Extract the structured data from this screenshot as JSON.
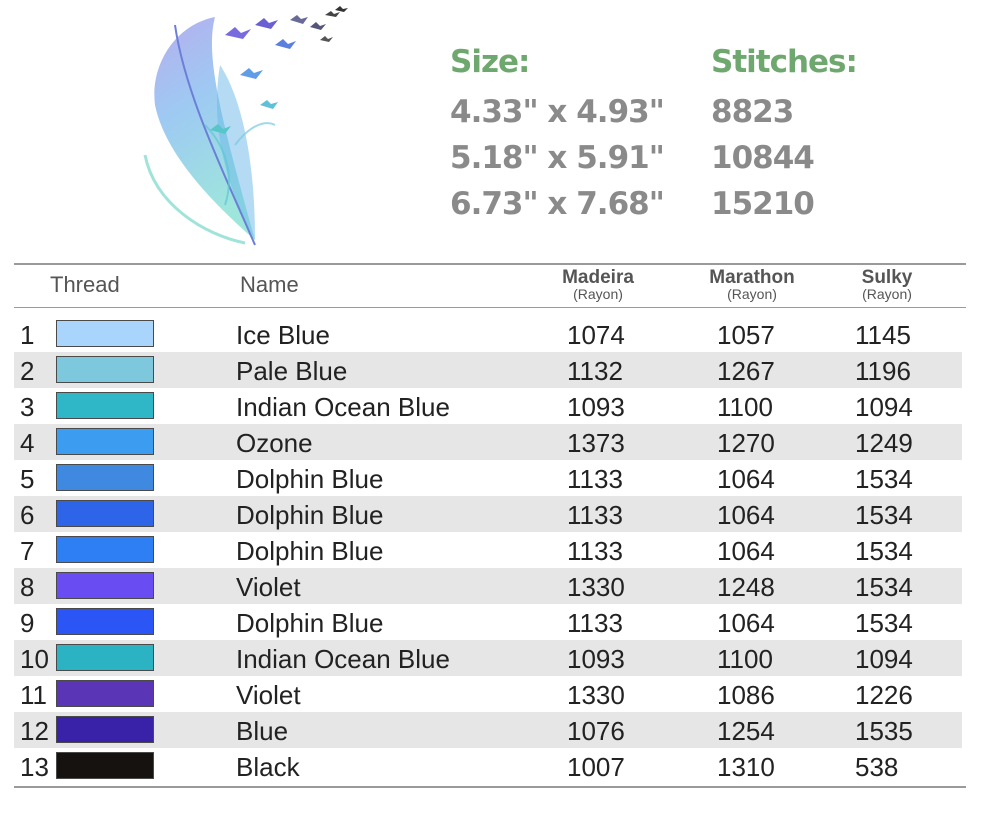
{
  "specs": {
    "size_label": "Size:",
    "stitches_label": "Stitches:",
    "sizes": [
      "4.33\" x 4.93\"",
      "5.18\" x 5.91\"",
      "6.73\" x 7.68\""
    ],
    "stitches": [
      "8823",
      "10844",
      "15210"
    ]
  },
  "table": {
    "headers": {
      "thread": "Thread",
      "name": "Name",
      "madeira": "Madeira",
      "marathon": "Marathon",
      "sulky": "Sulky",
      "rayon": "(Rayon)"
    },
    "rows": [
      {
        "n": "1",
        "color": "#a9d4fb",
        "name": "Ice Blue",
        "madeira": "1074",
        "marathon": "1057",
        "sulky": "1145"
      },
      {
        "n": "2",
        "color": "#7ec8de",
        "name": "Pale Blue",
        "madeira": "1132",
        "marathon": "1267",
        "sulky": "1196"
      },
      {
        "n": "3",
        "color": "#2fb6c7",
        "name": "Indian Ocean Blue",
        "madeira": "1093",
        "marathon": "1100",
        "sulky": "1094"
      },
      {
        "n": "4",
        "color": "#3b9cf0",
        "name": "Ozone",
        "madeira": "1373",
        "marathon": "1270",
        "sulky": "1249"
      },
      {
        "n": "5",
        "color": "#3f8ae0",
        "name": "Dolphin Blue",
        "madeira": "1133",
        "marathon": "1064",
        "sulky": "1534"
      },
      {
        "n": "6",
        "color": "#2d64e8",
        "name": "Dolphin Blue",
        "madeira": "1133",
        "marathon": "1064",
        "sulky": "1534"
      },
      {
        "n": "7",
        "color": "#2e7ef4",
        "name": "Dolphin Blue",
        "madeira": "1133",
        "marathon": "1064",
        "sulky": "1534"
      },
      {
        "n": "8",
        "color": "#6a4df2",
        "name": "Violet",
        "madeira": "1330",
        "marathon": "1248",
        "sulky": "1534"
      },
      {
        "n": "9",
        "color": "#2b55f5",
        "name": "Dolphin Blue",
        "madeira": "1133",
        "marathon": "1064",
        "sulky": "1534"
      },
      {
        "n": "10",
        "color": "#2bb3c4",
        "name": "Indian Ocean Blue",
        "madeira": "1093",
        "marathon": "1100",
        "sulky": "1094"
      },
      {
        "n": "11",
        "color": "#5a35b5",
        "name": "Violet",
        "madeira": "1330",
        "marathon": "1086",
        "sulky": "1226"
      },
      {
        "n": "12",
        "color": "#3a22a8",
        "name": "Blue",
        "madeira": "1076",
        "marathon": "1254",
        "sulky": "1535"
      },
      {
        "n": "13",
        "color": "#151210",
        "name": "Black",
        "madeira": "1007",
        "marathon": "1310",
        "sulky": "538"
      }
    ]
  }
}
